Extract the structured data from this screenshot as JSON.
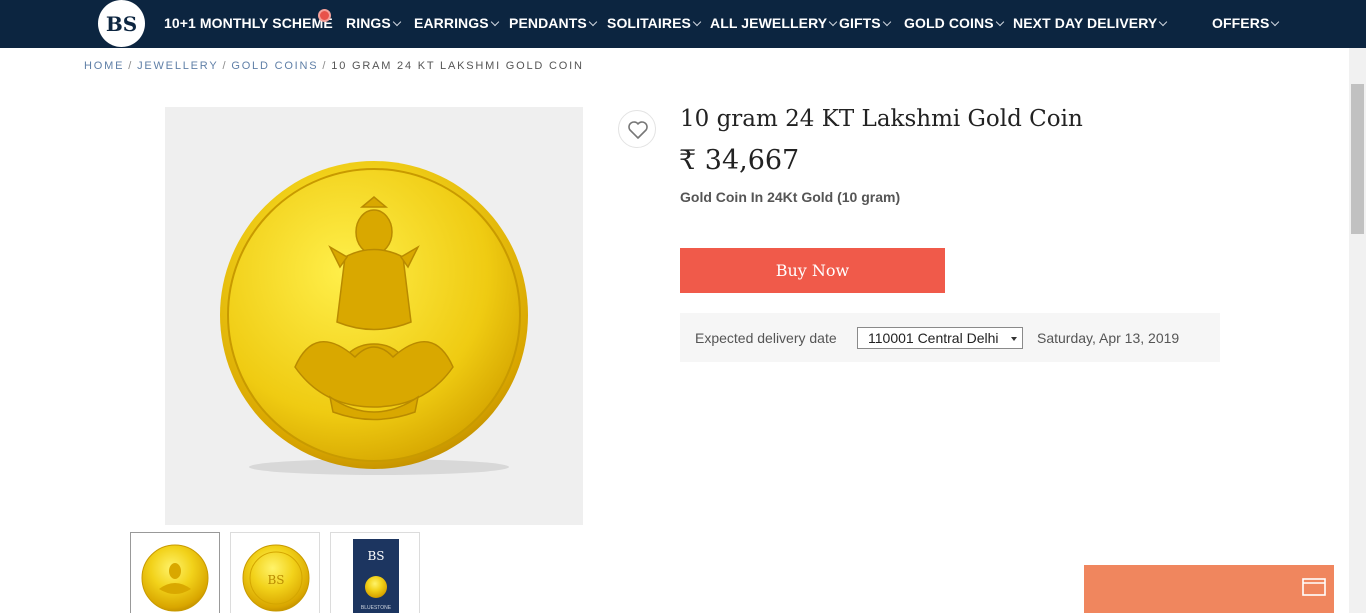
{
  "nav": {
    "logo_text": "BS",
    "items": [
      {
        "label": "10+1 MONTHLY SCHEME",
        "dropdown": false
      },
      {
        "label": "RINGS",
        "dropdown": true
      },
      {
        "label": "EARRINGS",
        "dropdown": true
      },
      {
        "label": "PENDANTS",
        "dropdown": true
      },
      {
        "label": "SOLITAIRES",
        "dropdown": true
      },
      {
        "label": "ALL JEWELLERY",
        "dropdown": true
      },
      {
        "label": "GIFTS",
        "dropdown": true
      },
      {
        "label": "GOLD COINS",
        "dropdown": true
      },
      {
        "label": "NEXT DAY DELIVERY",
        "dropdown": true
      },
      {
        "label": "OFFERS",
        "dropdown": true
      }
    ],
    "colors": {
      "background": "#0c2540",
      "badge": "#e8524a"
    }
  },
  "breadcrumb": {
    "items": [
      "HOME",
      "JEWELLERY",
      "GOLD COINS"
    ],
    "current": "10 GRAM 24 KT LAKSHMI GOLD COIN"
  },
  "gallery": {
    "main_image": "lakshmi-gold-coin-image",
    "thumbnails": [
      "lakshmi-coin-front-thumbnail",
      "coin-back-thumbnail",
      "coin-packaging-thumbnail"
    ],
    "packaging_text": "BLUESTONE"
  },
  "product": {
    "title": "10 gram 24 KT Lakshmi Gold Coin",
    "price": "₹ 34,667",
    "subtitle": "Gold Coin In 24Kt Gold (10 gram)",
    "buy_label": "Buy Now",
    "colors": {
      "buy_button": "#f05a4a"
    }
  },
  "delivery": {
    "label": "Expected delivery date",
    "pincode": "110001 Central Delhi",
    "date": "Saturday, Apr 13, 2019"
  },
  "chat_widget": {
    "icon": "chat-window-icon",
    "color": "#f0865e"
  }
}
